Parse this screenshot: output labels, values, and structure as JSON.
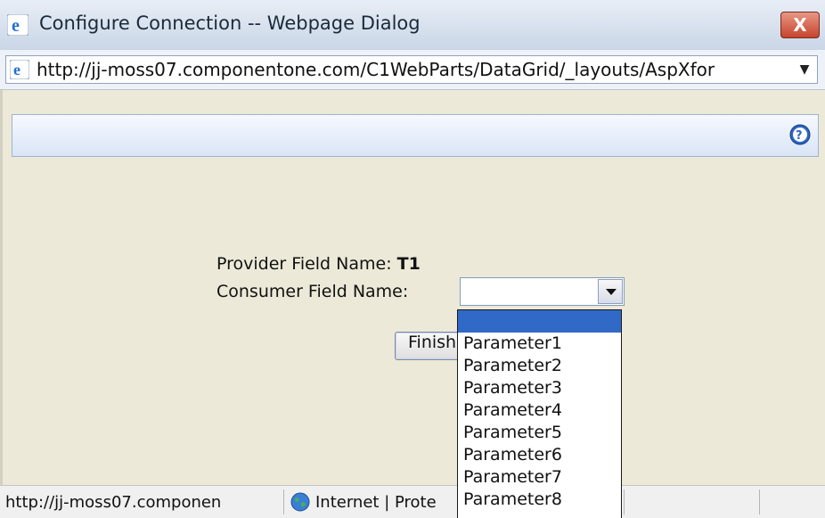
{
  "window": {
    "title": "Configure Connection -- Webpage Dialog",
    "close_label": "X"
  },
  "address": {
    "url": "http://jj-moss07.componentone.com/C1WebParts/DataGrid/_layouts/AspXfor"
  },
  "form": {
    "provider_label": "Provider Field Name:",
    "provider_value": "T1",
    "consumer_label": "Consumer Field Name:",
    "consumer_value": "",
    "finish_label": "Finish"
  },
  "dropdown": {
    "options": [
      "",
      "Parameter1",
      "Parameter2",
      "Parameter3",
      "Parameter4",
      "Parameter5",
      "Parameter6",
      "Parameter7",
      "Parameter8"
    ],
    "selected_index": 0
  },
  "status": {
    "url": "http://jj-moss07.componen",
    "zone": "Internet | Prote"
  },
  "colors": {
    "highlight": "#3169c6",
    "dialog_bg": "#ece9d8"
  },
  "icons": {
    "title": "ie-icon",
    "address": "ie-icon",
    "help": "help-icon",
    "zone": "globe-icon"
  }
}
